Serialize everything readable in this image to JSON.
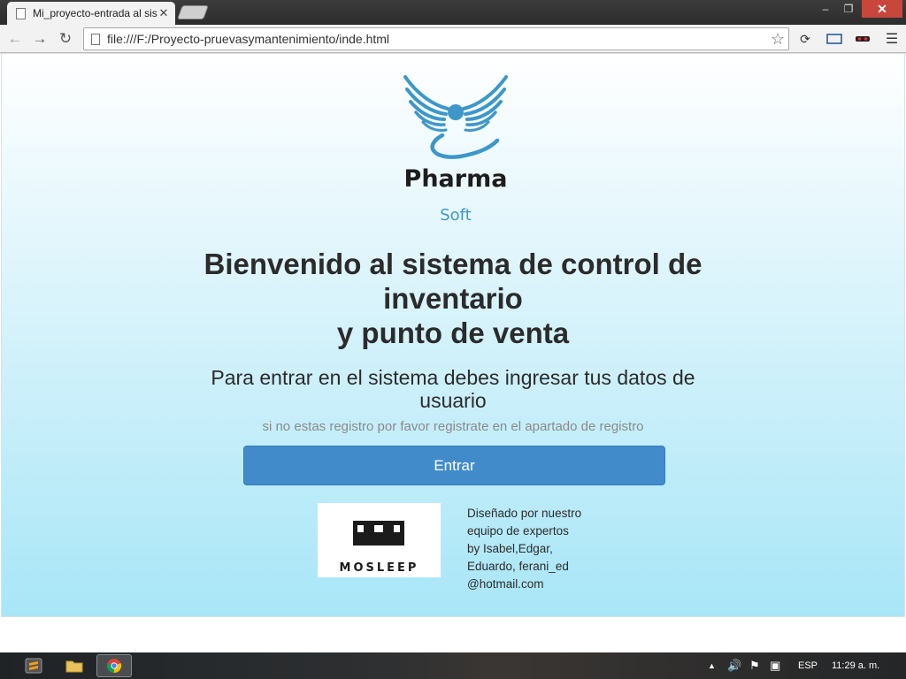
{
  "browser": {
    "tab_title": "Mi_proyecto-entrada al sis",
    "tab_close": "✕",
    "url": "file:///F:/Proyecto-pruevasymantenimiento/inde.html",
    "window_controls": {
      "minimize": "–",
      "maximize": "❐",
      "close": "✕"
    },
    "icons": {
      "back": "arrow-left-icon",
      "forward": "arrow-right-icon",
      "reload": "reload-icon",
      "bookmark": "star-icon",
      "menu": "hamburger-menu-icon"
    }
  },
  "page": {
    "logo": {
      "word": "Pharma",
      "sub": "Soft",
      "colors": {
        "wings": "#3d97c9",
        "text": "#1d1d1d"
      }
    },
    "headline": {
      "line1": "Bienvenido al sistema de control de",
      "line2": "inventario",
      "line3": "y punto de venta"
    },
    "subhead": "Para entrar en el sistema debes ingresar tus datos de usuario",
    "hint": "si no estas registro por favor registrate en el apartado de registro",
    "enter_button": "Entrar",
    "brand_image": {
      "text": "MOSLEEP"
    },
    "credits": [
      "Diseñado por nuestro",
      "equipo de expertos",
      "by Isabel,Edgar,",
      "Eduardo, ferani_ed",
      "@hotmail.com"
    ],
    "colors": {
      "button": "#428bca",
      "gradient_end": "#a8e6f7"
    }
  },
  "taskbar": {
    "apps": [
      "sublime-text-icon",
      "file-explorer-icon",
      "chrome-icon"
    ],
    "tray": {
      "language": "ESP",
      "clock": "11:29 a. m."
    }
  }
}
